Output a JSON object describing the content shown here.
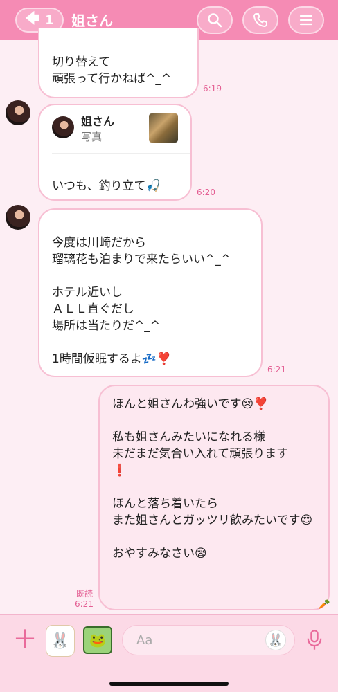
{
  "header": {
    "back_count": "1",
    "title": "姐さん",
    "bg_color": "#f58bb4"
  },
  "messages": [
    {
      "text": "切り替えて\n頑張って行かねば^_^",
      "time": "6:19"
    },
    {
      "quote_name": "姐さん",
      "quote_type": "写真",
      "text": "いつも、釣り立て🎣",
      "time": "6:20"
    },
    {
      "text": "今度は川崎だから\n瑠璃花も泊まりで来たらいい^_^\n\nホテル近いし\nＡＬＬ直ぐだし\n場所は当たりだ^_^\n\n1時間仮眠するよ💤❣️",
      "time": "6:21"
    },
    {
      "text": "ほんと姐さんわ強いです😢❣️\n\n私も姐さんみたいになれる様\n未だまだ気合い入れて頑張ります\n❗️\n\nほんと落ち着いたら\nまた姐さんとガッツリ飲みたいです😍\n\nおやすみなさい😪",
      "read": "既読",
      "time": "6:21"
    }
  ],
  "input": {
    "placeholder": "Aa"
  }
}
